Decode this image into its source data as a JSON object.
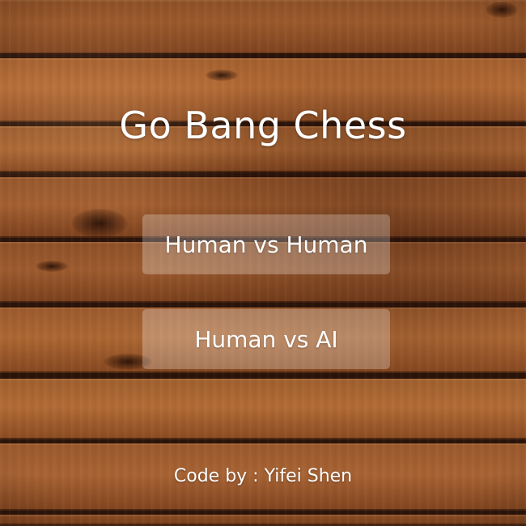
{
  "game": {
    "title": "Go Bang Chess",
    "menu": {
      "human_vs_human": "Human vs Human",
      "human_vs_ai": "Human vs AI"
    },
    "credit": "Code by : Yifei Shen"
  },
  "colors": {
    "text": "#ffffff",
    "wood_base": "#8a4a22",
    "plank_gap": "#2b140a",
    "button_overlay": "rgba(255,255,255,0.26)"
  }
}
